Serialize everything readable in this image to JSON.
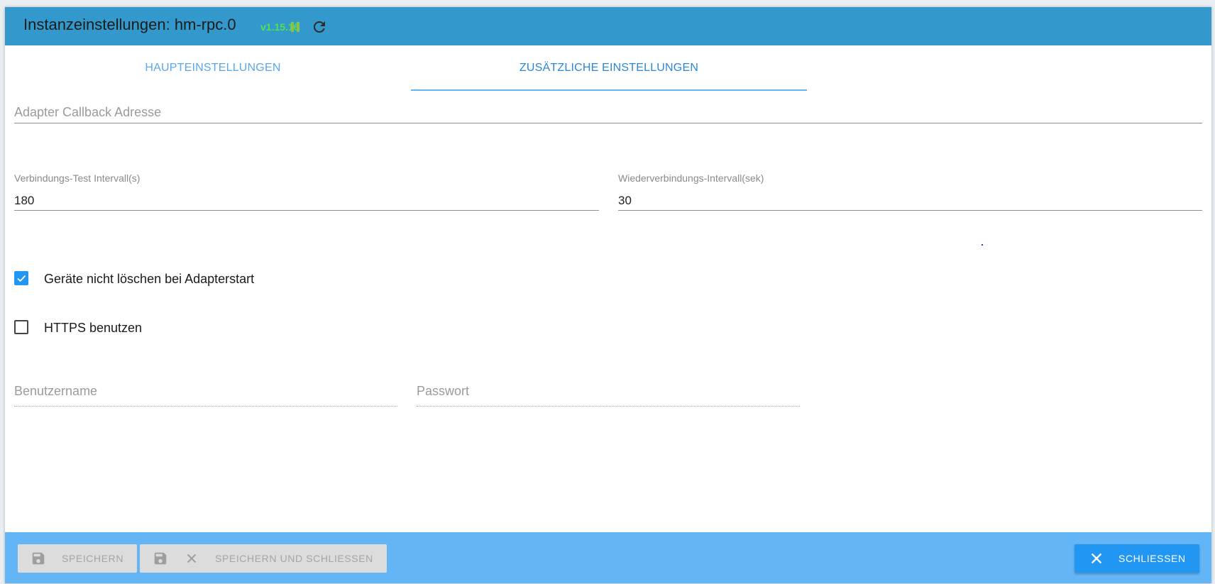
{
  "window": {
    "title": "Instanzeinstellungen: hm-rpc.0",
    "version": "v1.15.16",
    "icons": {
      "pause": "pause-icon",
      "reload": "reload-icon"
    },
    "colors": {
      "titlebar": "#3399cc",
      "version": "#4ee44e",
      "footer": "#64b5f6",
      "accent": "#2196f3"
    }
  },
  "tabs": [
    {
      "label": "HAUPTEINSTELLUNGEN",
      "active": false
    },
    {
      "label": "ZUSÄTZLICHE EINSTELLUNGEN",
      "active": true
    }
  ],
  "fields": {
    "callback_address": {
      "label": "Adapter Callback Adresse",
      "value": ""
    },
    "connection_test_interval": {
      "label": "Verbindungs-Test Intervall(s)",
      "value": "180"
    },
    "reconnect_interval": {
      "label": "Wiederverbindungs-Intervall(sek)",
      "value": "30"
    },
    "username": {
      "label": "Benutzername",
      "value": ""
    },
    "password": {
      "label": "Passwort",
      "value": ""
    }
  },
  "checkboxes": {
    "dont_delete_devices": {
      "label": "Geräte nicht löschen bei Adapterstart",
      "checked": true
    },
    "use_https": {
      "label": "HTTPS benutzen",
      "checked": false
    }
  },
  "footer": {
    "save_label": "SPEICHERN",
    "save_close_label": "SPEICHERN UND SCHLIESSEN",
    "close_label": "SCHLIESSEN"
  }
}
